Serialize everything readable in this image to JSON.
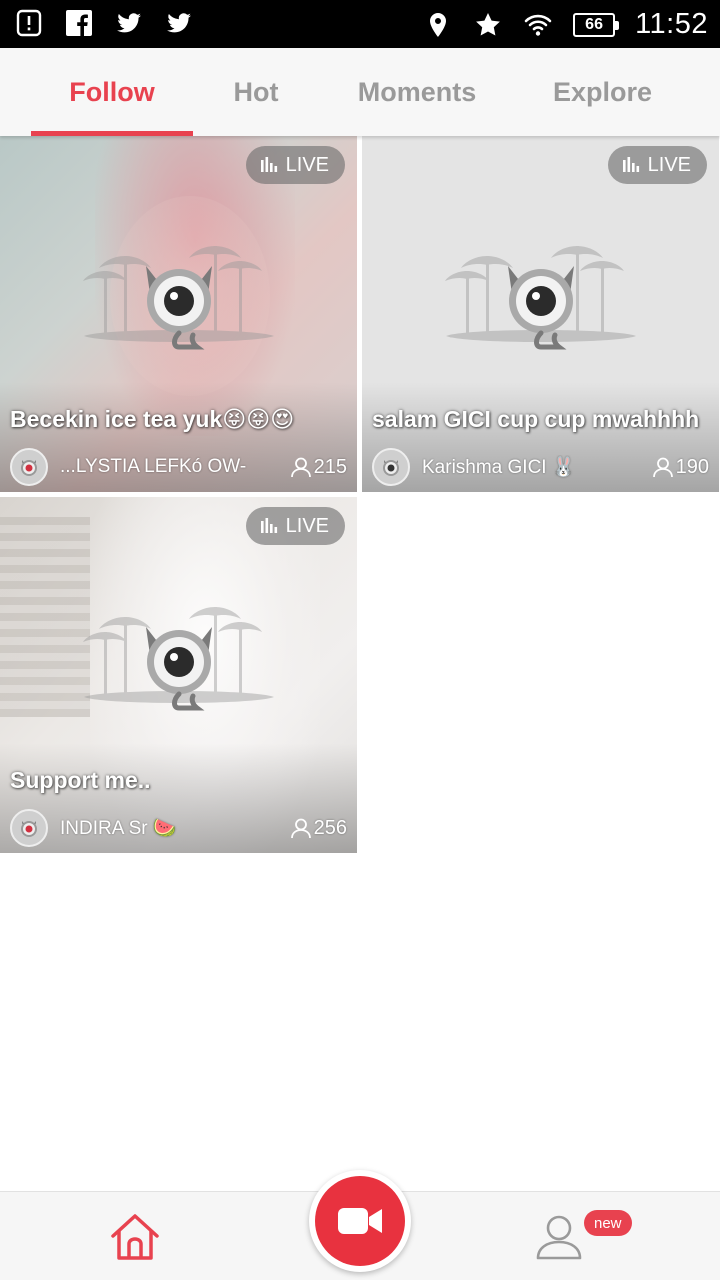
{
  "status_bar": {
    "time": "11:52",
    "battery": "66",
    "left_icons": [
      "alert-icon",
      "facebook-icon",
      "twitter-icon",
      "twitter-icon"
    ],
    "right_icons": [
      "location-icon",
      "star-icon",
      "wifi-icon",
      "battery-icon"
    ]
  },
  "tabs": [
    {
      "label": "Follow",
      "active": true
    },
    {
      "label": "Hot",
      "active": false
    },
    {
      "label": "Moments",
      "active": false
    },
    {
      "label": "Explore",
      "active": false
    }
  ],
  "colors": {
    "accent": "#e8424f",
    "tab_inactive": "#9a9a9a"
  },
  "streams": [
    {
      "live_label": "LIVE",
      "title": "Becekin ice tea yuk😝😝😍",
      "host": "...LYSTIA LEFKó OW-",
      "viewers": "215"
    },
    {
      "live_label": "LIVE",
      "title": "salam GICI cup cup mwahhhh",
      "host": "Karishma GICI 🐰",
      "viewers": "190"
    },
    {
      "live_label": "LIVE",
      "title": "Support me..",
      "host": "INDIRA Sr 🍉",
      "viewers": "256"
    }
  ],
  "bottom_nav": {
    "home_icon": "home-icon",
    "record_icon": "video-camera-icon",
    "profile_icon": "user-icon",
    "profile_badge": "new"
  }
}
